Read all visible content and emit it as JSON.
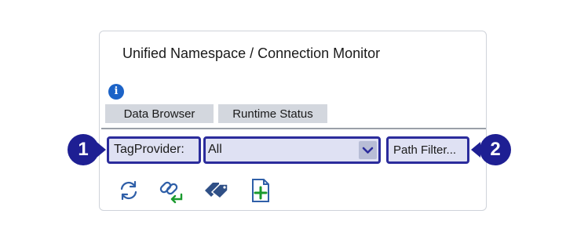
{
  "window": {
    "title": "Unified Namespace / Connection Monitor"
  },
  "icons": {
    "info": "info-icon"
  },
  "tabs": [
    {
      "label": "Data Browser"
    },
    {
      "label": "Runtime Status"
    }
  ],
  "filter_bar": {
    "tag_provider_label": "TagProvider:",
    "tag_provider_value": "All",
    "path_filter_label": "Path Filter..."
  },
  "toolbar": {
    "icons": [
      "refresh-icon",
      "link-connect-icon",
      "tags-icon",
      "add-document-icon"
    ]
  },
  "callouts": [
    {
      "number": "1"
    },
    {
      "number": "2"
    }
  ],
  "colors": {
    "accent": "#2b2c9c",
    "callout": "#1e1f93",
    "info": "#1c63c7",
    "tab_bg": "#d3d7de",
    "highlight_bg": "#dfe1f3",
    "icon_blue": "#2f5fa8",
    "icon_green": "#1a9a2e"
  }
}
